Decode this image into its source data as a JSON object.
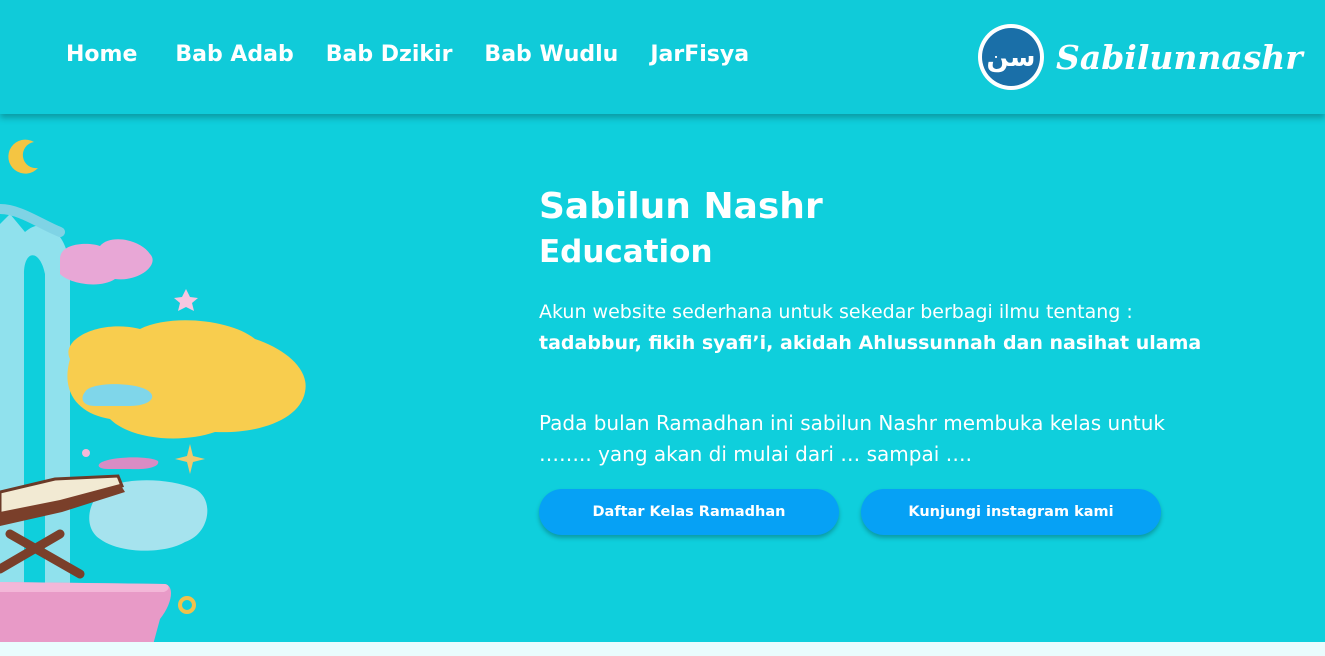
{
  "nav": {
    "links": [
      "Home",
      "Bab Adab",
      "Bab Dzikir",
      "Bab Wudlu",
      "JarFisya"
    ]
  },
  "brand": {
    "logo_glyph": "سن",
    "name": "Sabilunnashr"
  },
  "hero": {
    "title": "Sabilun Nashr",
    "subtitle": "Education",
    "description": "Akun website sederhana untuk sekedar berbagi ilmu tentang :",
    "description_bold": "tadabbur, fikih syafi’i, akidah Ahlussunnah dan nasihat ulama",
    "announcement": "Pada bulan Ramadhan ini sabilun Nashr membuka kelas untuk …….. yang akan di mulai dari … sampai ….",
    "buttons": {
      "register": "Daftar Kelas Ramadhan",
      "instagram": "Kunjungi instagram kami"
    }
  },
  "colors": {
    "background": "#0fcfdc",
    "navbar": "#10cbd9",
    "button": "#06a1f5",
    "logo": "#1a6fa8",
    "text": "#ffffff"
  },
  "icons": [
    "crescent-moon-icon",
    "open-quran-icon",
    "star-icon",
    "sparkle-icon"
  ]
}
